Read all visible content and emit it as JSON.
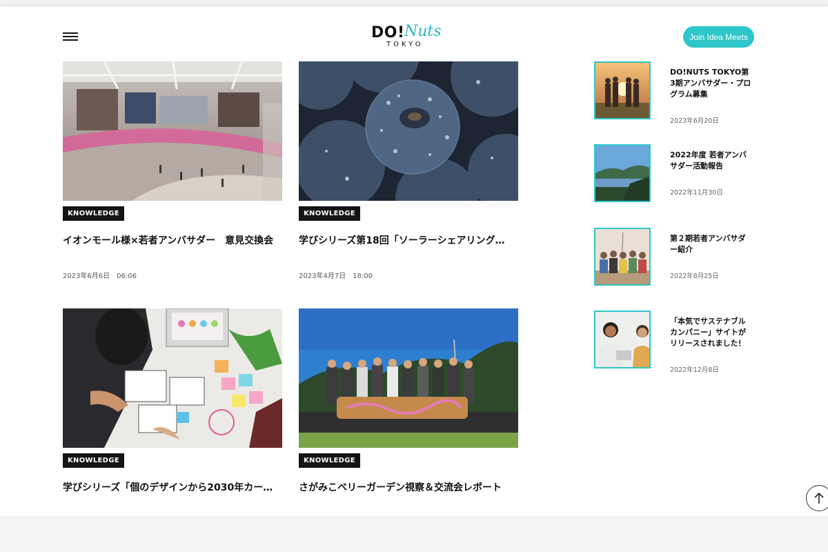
{
  "header": {
    "logo_main": "DO!",
    "logo_script": "Nuts",
    "logo_sub": "TOKYO",
    "join_label": "Join Idea Meets"
  },
  "articles": [
    {
      "tag": "KNOWLEDGE",
      "title": "イオンモール様×若者アンバサダー　意見交換会",
      "date": "2023年6月6日　06:06"
    },
    {
      "tag": "KNOWLEDGE",
      "title": "学びシリーズ第18回「ソーラーシェアリング…",
      "date": "2023年4月7日　18:00"
    },
    {
      "tag": "KNOWLEDGE",
      "title": "学びシリーズ「個のデザインから2030年カー…"
    },
    {
      "tag": "KNOWLEDGE",
      "title": "さがみこベリーガーデン視察＆交流会レポート"
    }
  ],
  "sidebar": [
    {
      "title": "DO!NUTS TOKYO第3期アンバサダー・プログラム募集",
      "date": "2023年6月20日"
    },
    {
      "title": "2022年度 若者アンバサダー活動報告",
      "date": "2022年11月30日"
    },
    {
      "title": "第２期若者アンバサダー紹介",
      "date": "2022年8月25日"
    },
    {
      "title": "「本気でサステナブルカンパニー」サイトがリリースされました！",
      "date": "2022年12月8日"
    }
  ],
  "colors": {
    "accent": "#2ec6c8",
    "tag_bg": "#141414"
  }
}
